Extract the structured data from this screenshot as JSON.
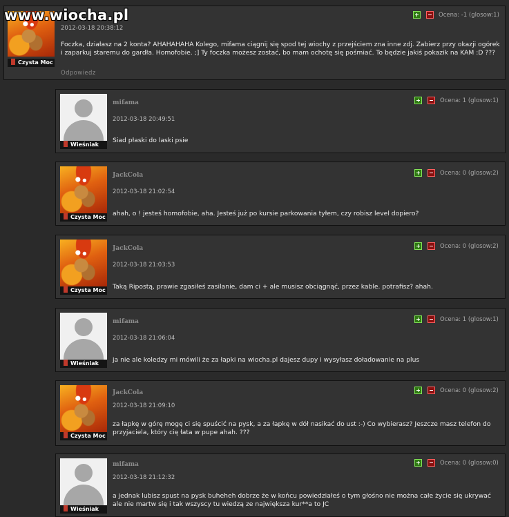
{
  "watermark": "www.wiocha.pl",
  "reply_label": "Odpowiedz",
  "comments": [
    {
      "user": "",
      "rank": "Czysta Moc",
      "date": "2012-03-18 20:38:12",
      "score": "Ocena: -1 (glosow:1)",
      "text": "Foczka, działasz na 2 konta? AHAHAHAHA Kolego, mifama ciągnij się spod tej wiochy z przejściem zna inne zdj. Zabierz przy okazji ogórek i zaparkuj staremu do gardła. Homofobie. ;] Ty foczka możesz zostać, bo mam ochotę się pośmiać. To będzie jakiś pokazik na KAM :D ???"
    },
    {
      "user": "mifama",
      "rank": "Wieśniak",
      "date": "2012-03-18 20:49:51",
      "score": "Ocena: 1 (glosow:1)",
      "text": "Siad płaski do laski psie"
    },
    {
      "user": "JackCola",
      "rank": "Czysta Moc",
      "date": "2012-03-18 21:02:54",
      "score": "Ocena: 0 (glosow:2)",
      "text": "ahah, o ! jesteś homofobie, aha. Jesteś już po kursie parkowania tyłem, czy robisz level dopiero?"
    },
    {
      "user": "JackCola",
      "rank": "Czysta Moc",
      "date": "2012-03-18 21:03:53",
      "score": "Ocena: 0 (glosow:2)",
      "text": "Taką Ripostą, prawie zgasiłeś zasilanie, dam ci + ale musisz obciągnąć, przez kable. potrafisz? ahah."
    },
    {
      "user": "mifama",
      "rank": "Wieśniak",
      "date": "2012-03-18 21:06:04",
      "score": "Ocena: 1 (glosow:1)",
      "text": "ja nie ale koledzy mi mówili że za łapki na wiocha.pl dajesz dupy i wysyłasz doładowanie na plus"
    },
    {
      "user": "JackCola",
      "rank": "Czysta Moc",
      "date": "2012-03-18 21:09:10",
      "score": "Ocena: 0 (glosow:2)",
      "text": "za łapkę w górę mogę ci się spuścić na pysk, a za łapkę w dół nasikać do ust :-) Co wybierasz? Jeszcze masz telefon do przyjaciela, który cię łata w pupe ahah. ???"
    },
    {
      "user": "mifama",
      "rank": "Wieśniak",
      "date": "2012-03-18 21:12:32",
      "score": "Ocena: 0 (glosow:0)",
      "text": "a jednak lubisz spust na pysk buheheh dobrze że w końcu powiedziałeś o tym głośno nie można całe życie się ukrywać ale nie martw się i tak wszyscy tu wiedzą ze największa kur**a to JC"
    }
  ]
}
